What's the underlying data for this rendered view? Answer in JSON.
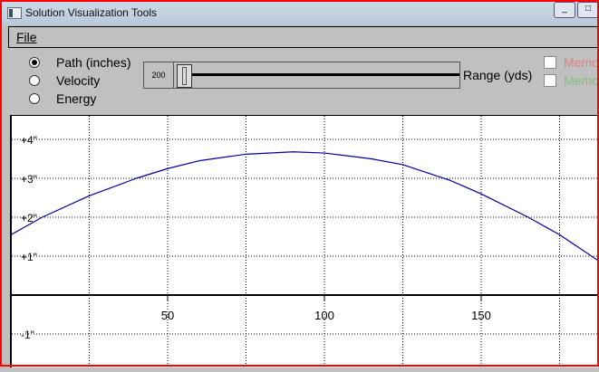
{
  "window": {
    "title": "Solution Visualization Tools"
  },
  "menu": {
    "file": "File"
  },
  "modes": [
    {
      "label": "Path (inches)",
      "selected": true
    },
    {
      "label": "Velocity",
      "selected": false
    },
    {
      "label": "Energy",
      "selected": false
    }
  ],
  "slider": {
    "value": "200",
    "label": "Range (yds)"
  },
  "memos": [
    {
      "label": "Memo",
      "color": "#e08080"
    },
    {
      "label": "Memo",
      "color": "#80c080"
    }
  ],
  "chart_data": {
    "type": "line",
    "xlabel": "Range (yds)",
    "ylabel": "Path (inches)",
    "xlim": [
      0,
      188
    ],
    "ylim": [
      -1.9,
      4.5
    ],
    "x_ticks": [
      {
        "v": 50,
        "label": "50"
      },
      {
        "v": 100,
        "label": "100"
      },
      {
        "v": 150,
        "label": "150"
      }
    ],
    "x_grid": [
      25,
      50,
      75,
      100,
      125,
      150,
      175
    ],
    "y_ticks": [
      {
        "v": 4,
        "label": "+4\""
      },
      {
        "v": 3,
        "label": "+3\""
      },
      {
        "v": 2,
        "label": "+2\""
      },
      {
        "v": 1,
        "label": "+1\""
      },
      {
        "v": -1,
        "label": "-1\""
      }
    ],
    "series": [
      {
        "name": "path",
        "color": "#0000a0",
        "x": [
          0,
          10,
          25,
          40,
          50,
          60,
          75,
          90,
          100,
          115,
          125,
          140,
          150,
          165,
          175,
          188
        ],
        "y": [
          1.55,
          2.0,
          2.55,
          3.0,
          3.25,
          3.45,
          3.62,
          3.68,
          3.65,
          3.5,
          3.35,
          2.95,
          2.6,
          2.0,
          1.55,
          0.85
        ]
      }
    ]
  }
}
